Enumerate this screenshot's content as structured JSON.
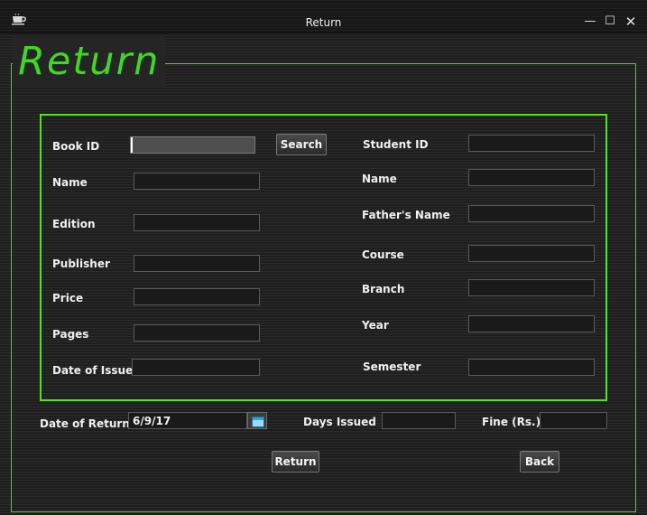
{
  "window": {
    "title": "Return",
    "minimize_glyph": "—",
    "maximize_glyph": "☐",
    "close_glyph": "✕",
    "app_icon": "coffee-cup-icon"
  },
  "header": {
    "title": "Return"
  },
  "book": {
    "book_id_label": "Book ID",
    "book_id_value": "",
    "search_label": "Search",
    "name_label": "Name",
    "name_value": "",
    "edition_label": "Edition",
    "edition_value": "",
    "publisher_label": "Publisher",
    "publisher_value": "",
    "price_label": "Price",
    "price_value": "",
    "pages_label": "Pages",
    "pages_value": "",
    "date_of_issue_label": "Date of Issue",
    "date_of_issue_value": ""
  },
  "student": {
    "student_id_label": "Student ID",
    "student_id_value": "",
    "name_label": "Name",
    "name_value": "",
    "fathers_name_label": "Father's Name",
    "fathers_name_value": "",
    "course_label": "Course",
    "course_value": "",
    "branch_label": "Branch",
    "branch_value": "",
    "year_label": "Year",
    "year_value": "",
    "semester_label": "Semester",
    "semester_value": ""
  },
  "footer": {
    "date_of_return_label": "Date of Return",
    "date_of_return_value": "6/9/17",
    "calendar_icon": "calendar-icon",
    "days_issued_label": "Days Issued",
    "days_issued_value": "",
    "fine_label": "Fine (Rs.)",
    "fine_value": "",
    "return_button": "Return",
    "back_button": "Back"
  },
  "colors": {
    "accent_green": "#3ed920",
    "panel_border": "#55e01e",
    "frame_border": "#4ed02a",
    "background": "#272727"
  }
}
